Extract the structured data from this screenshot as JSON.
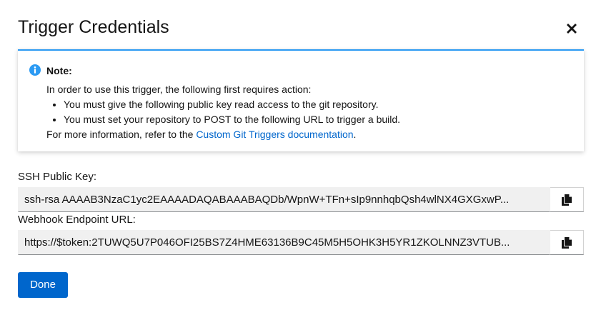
{
  "modal": {
    "title": "Trigger Credentials",
    "close_icon": "close-icon"
  },
  "alert": {
    "icon": "info-circle-icon",
    "accent_color": "#2b9af3",
    "title": "Note:",
    "intro": "In order to use this trigger, the following first requires action:",
    "items": [
      "You must give the following public key read access to the git repository.",
      "You must set your repository to POST to the following URL to trigger a build."
    ],
    "more_info_prefix": "For more information, refer to the ",
    "more_info_link": "Custom Git Triggers documentation",
    "more_info_suffix": "."
  },
  "fields": {
    "ssh_key": {
      "label": "SSH Public Key:",
      "value": "ssh-rsa AAAAB3NzaC1yc2EAAAADAQABAAABAQDb/WpnW+TFn+sIp9nnhqbQsh4wlNX4GXGxwP...",
      "copy_icon": "copy-icon"
    },
    "webhook_url": {
      "label": "Webhook Endpoint URL:",
      "value": "https://$token:2TUWQ5U7P046OFI25BS7Z4HME63136B9C45M5H5OHK3H5YR1ZKOLNNZ3VTUB...",
      "copy_icon": "copy-icon"
    }
  },
  "actions": {
    "done_label": "Done",
    "primary_color": "#0066cc"
  }
}
